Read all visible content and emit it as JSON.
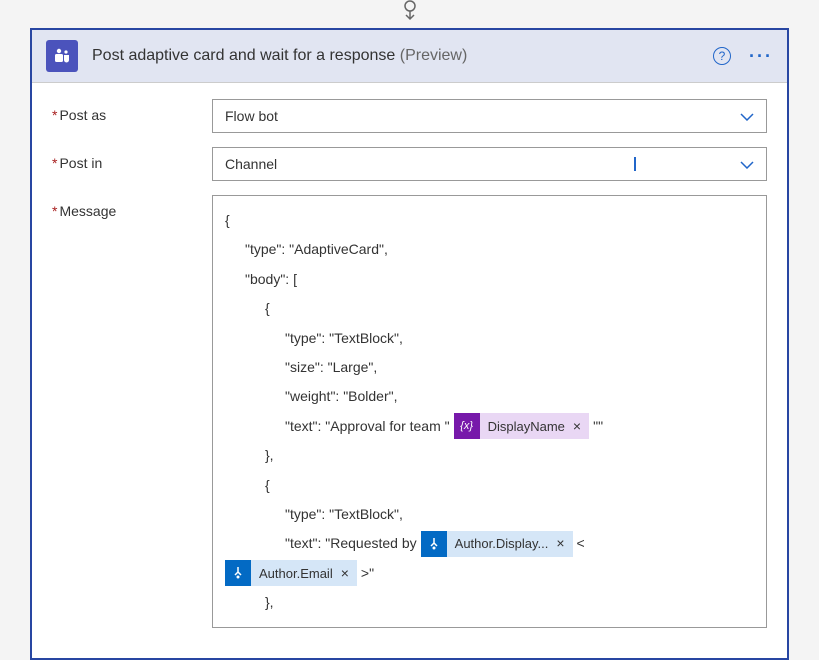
{
  "header": {
    "title": "Post adaptive card and wait for a response",
    "tag": "(Preview)"
  },
  "fields": {
    "postAs": {
      "label": "Post as",
      "value": "Flow bot"
    },
    "postIn": {
      "label": "Post in",
      "value": "Channel"
    },
    "message": {
      "label": "Message"
    }
  },
  "messageContent": {
    "line1": "{",
    "line2": "\"type\": \"AdaptiveCard\",",
    "line3": "\"body\": [",
    "line4": "{",
    "line5": "\"type\": \"TextBlock\",",
    "line6": "\"size\": \"Large\",",
    "line7": "\"weight\": \"Bolder\",",
    "line8_pre": "\"text\": \"Approval for team \"",
    "line8_post": "\"\"",
    "line9": "},",
    "line10": "{",
    "line11": "\"type\": \"TextBlock\",",
    "line12_pre": "\"text\": \"Requested by",
    "line12_post": "<",
    "line13_post": ">\"",
    "line14": "},"
  },
  "tokens": {
    "displayName": "DisplayName",
    "authorDisplay": "Author.Display...",
    "authorEmail": "Author.Email"
  }
}
